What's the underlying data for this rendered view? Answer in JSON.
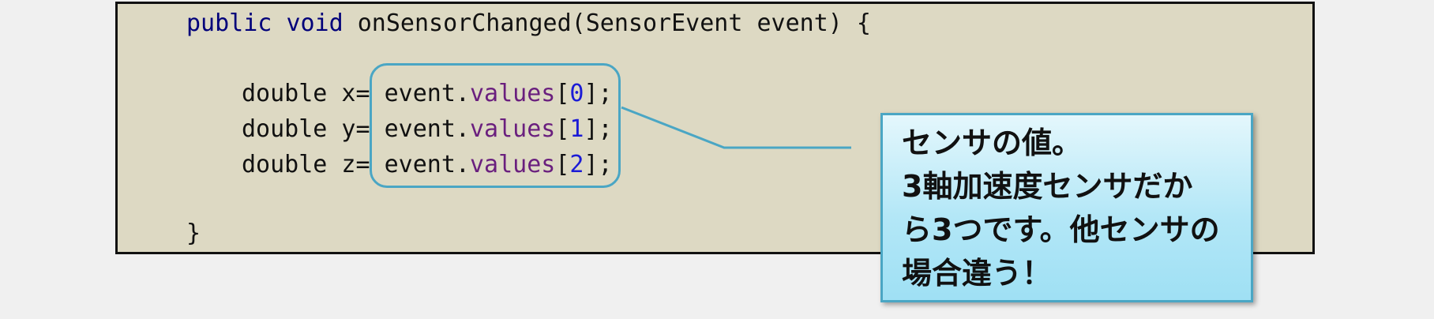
{
  "code": {
    "signature": {
      "kw1": "public",
      "kw2": "void",
      "rest": " onSensorChanged(SensorEvent event) {"
    },
    "lines": [
      {
        "prefix": "double x= event.",
        "field": "values",
        "open": "[",
        "index": "0",
        "close": "];"
      },
      {
        "prefix": "double y= event.",
        "field": "values",
        "open": "[",
        "index": "1",
        "close": "];"
      },
      {
        "prefix": "double z= event.",
        "field": "values",
        "open": "[",
        "index": "2",
        "close": "];"
      }
    ],
    "closing_brace": "}"
  },
  "callout": {
    "lines": [
      "センサの値。",
      "3軸加速度センサだか",
      "ら3つです。他センサの",
      "場合違う！"
    ]
  },
  "colors": {
    "panel_bg": "#ddd9c3",
    "keyword": "#00007a",
    "field": "#6a1f7e",
    "number": "#1b1bd6",
    "accent_border": "#4aa6c4"
  }
}
